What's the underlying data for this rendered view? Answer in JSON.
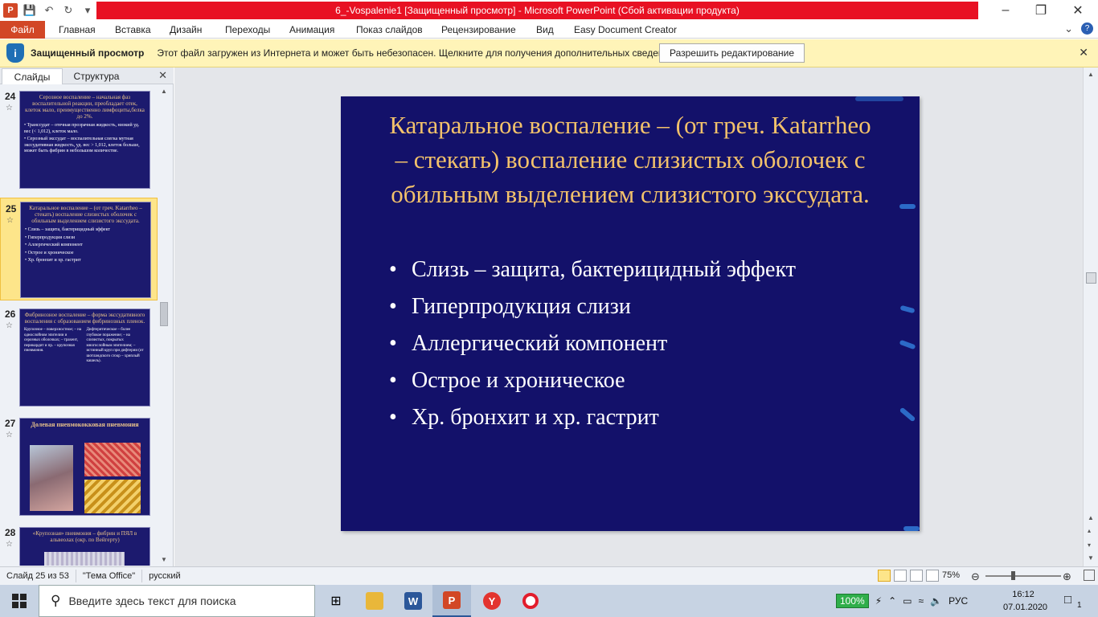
{
  "window": {
    "title": "6_-Vospalenie1 [Защищенный просмотр] - Microsoft PowerPoint (Сбой активации продукта)",
    "app_icon_letter": "P"
  },
  "ribbon": {
    "tabs": [
      "Файл",
      "Главная",
      "Вставка",
      "Дизайн",
      "Переходы",
      "Анимация",
      "Показ слайдов",
      "Рецензирование",
      "Вид",
      "Easy Document Creator"
    ]
  },
  "protected_view": {
    "title": "Защищенный просмотр",
    "message": "Этот файл загружен из Интернета и может быть небезопасен. Щелкните для получения дополнительных сведений.",
    "button": "Разрешить редактирование"
  },
  "panel": {
    "tabs": [
      "Слайды",
      "Структура"
    ],
    "slides": [
      {
        "number": "24",
        "title": "Серозное воспаление – начальная фаз воспалительной реакции, преобладает отек, клеток мало, преимущественно лимфоциты,белка до 2%.",
        "bullets": [
          "Транссудат – отечная прозрачная жидкость, низкий уд. вес (< 1,012), клеток мало.",
          "Серозный экссудат – воспалительная слегка мутная экссудативная жидкость, уд. вес > 1,012, клеток больше, может быть фибрин в небольшом количестве."
        ]
      },
      {
        "number": "25",
        "title": "Катаральное воспаление – (от греч. Katarrheo – стекать) воспаление слизистых оболочек с обильным выделением слизистого экссудата.",
        "bullets": [
          "Слизь – защита, бактерицидный эффект",
          "Гиперпродукция слизи",
          "Аллергический компонент",
          "Острое и хроническое",
          "Хр. бронхит и хр. гастрит"
        ]
      },
      {
        "number": "26",
        "title": "Фибринозное воспаление – форма экссудативного воспаления с образованием фибринозных пленок.",
        "col_left": "Крупозное – поверхностное; – на однослойном эпителии и серозных оболочках; – трахеит, перикардит и пр. – крупозная пневмония.",
        "col_right": "Дифтеритическое – более глубокое поражение; – на слизистых, покрытых многослойным эпителием; – истинный круп при дифтерии (от шотландского croup – хриплый кашель)."
      },
      {
        "number": "27",
        "title": "Долевая пневмококковая пневмония"
      },
      {
        "number": "28",
        "title": "«Крупозная» пневмония – фибрин и ПЯЛ в альвеолах (окр. по Вейгерту)"
      }
    ]
  },
  "slide": {
    "title": "Катаральное воспаление – (от греч. Katarrheo – стекать) воспаление слизистых оболочек с обильным выделением слизистого экссудата.",
    "bullets": [
      "Слизь – защита, бактерицидный эффект",
      "Гиперпродукция слизи",
      "Аллергический компонент",
      "Острое и хроническое",
      "Хр. бронхит и хр. гастрит"
    ]
  },
  "status": {
    "slide_info": "Слайд 25 из 53",
    "theme": "\"Тема Office\"",
    "language": "русский",
    "zoom": "75%",
    "zoom_value": 0.75
  },
  "taskbar": {
    "search_placeholder": "Введите здесь текст для поиска",
    "battery": "100%",
    "lang": "РУС",
    "time": "16:12",
    "date": "07.01.2020",
    "notifications": "1"
  },
  "colors": {
    "title_bar": "#e81123",
    "file_tab": "#d24726",
    "slide_bg": "#13116a",
    "slide_title": "#f3c26b",
    "protected_bar": "#fff4b8"
  }
}
